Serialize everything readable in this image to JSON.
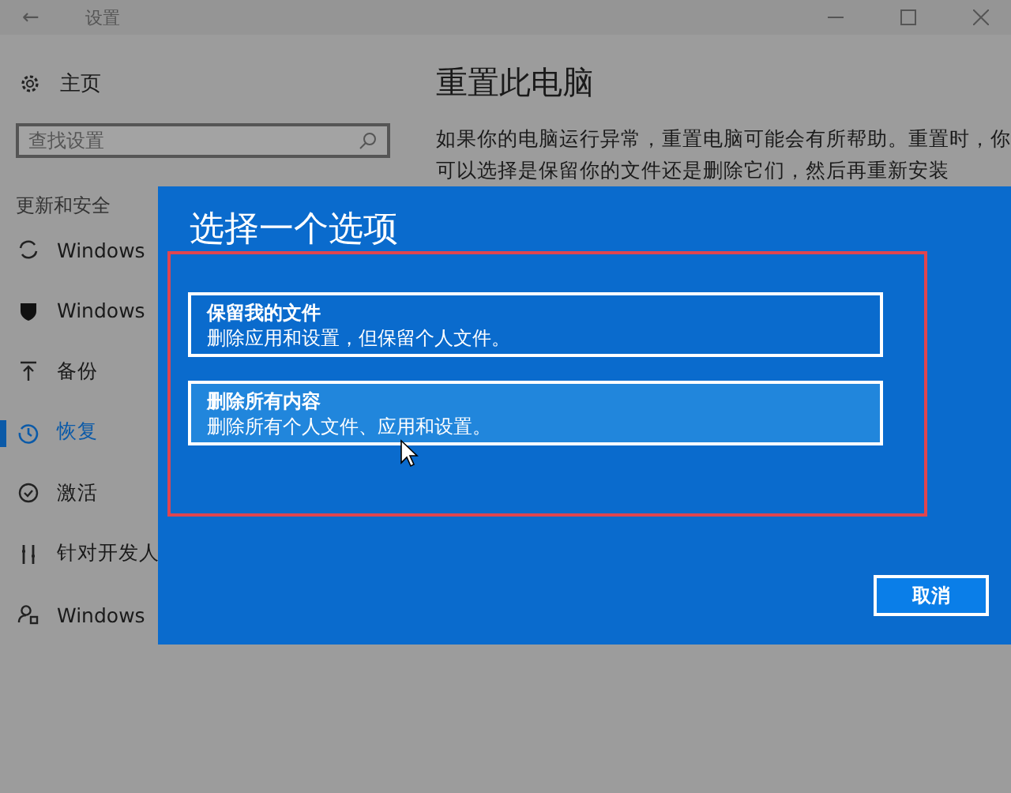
{
  "window": {
    "title": "设置",
    "back": "←"
  },
  "sidebar": {
    "home": "主页",
    "search": {
      "placeholder": "查找设置"
    },
    "section": "更新和安全",
    "items": [
      {
        "label": "Windows",
        "selected": false
      },
      {
        "label": "Windows",
        "selected": false
      },
      {
        "label": "备份",
        "selected": false
      },
      {
        "label": "恢复",
        "selected": true
      },
      {
        "label": "激活",
        "selected": false
      },
      {
        "label": "针对开发人",
        "selected": false
      },
      {
        "label": "Windows",
        "selected": false
      }
    ]
  },
  "content": {
    "title": "重置此电脑",
    "paragraph_lines": [
      "如果你的电脑运行异常，重置电脑可能会有所帮助。重置时，你",
      "可以选择是保留你的文件还是删除它们，然后再重新安装"
    ]
  },
  "dialog": {
    "title": "选择一个选项",
    "options": [
      {
        "title": "保留我的文件",
        "description": "删除应用和设置，但保留个人文件。",
        "highlighted": false
      },
      {
        "title": "删除所有内容",
        "description": "删除所有个人文件、应用和设置。",
        "highlighted": true
      }
    ],
    "cancel": "取消"
  }
}
